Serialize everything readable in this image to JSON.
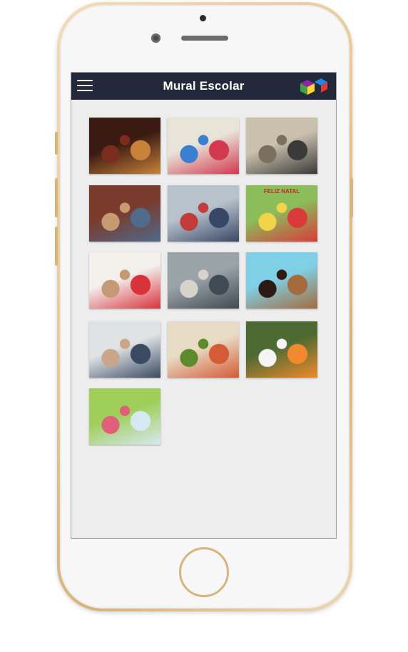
{
  "app": {
    "title": "Mural Escolar",
    "logo_colors": [
      "#8e24aa",
      "#43a047",
      "#fdd835",
      "#1e88e5",
      "#e53935"
    ]
  },
  "gallery": {
    "photos": [
      {
        "icon": "photo-party-crowd",
        "colors": [
          "#3a1a12",
          "#c9823a",
          "#7a2d1c"
        ]
      },
      {
        "icon": "photo-birthday-balloons",
        "colors": [
          "#e8e4d8",
          "#d2384e",
          "#3b7fd0"
        ]
      },
      {
        "icon": "photo-adults-toast",
        "colors": [
          "#c9c1ad",
          "#3b3a3a",
          "#7c6f5e"
        ]
      },
      {
        "icon": "photo-students-group",
        "colors": [
          "#7a3a2c",
          "#4f6a8a",
          "#c89a72"
        ]
      },
      {
        "icon": "photo-volleyball-gym",
        "colors": [
          "#b8c2cc",
          "#394766",
          "#c23b3b"
        ]
      },
      {
        "icon": "photo-christmas-board",
        "colors": [
          "#8bbd5b",
          "#d93b3b",
          "#f1d34a"
        ],
        "caption": "FELIZ NATAL"
      },
      {
        "icon": "photo-easter-costumes",
        "colors": [
          "#f3f0ec",
          "#d8323b",
          "#c49a76"
        ]
      },
      {
        "icon": "photo-classroom",
        "colors": [
          "#9aa3a8",
          "#3f4a52",
          "#d7d3cb"
        ]
      },
      {
        "icon": "photo-two-friends",
        "colors": [
          "#7fd0e6",
          "#a56a3d",
          "#2d1a12"
        ]
      },
      {
        "icon": "photo-teens-phones",
        "colors": [
          "#dfe3e4",
          "#3b4a63",
          "#c9a68a"
        ]
      },
      {
        "icon": "photo-kids-tablet",
        "colors": [
          "#e9dcc6",
          "#d35b36",
          "#5e8a2d"
        ]
      },
      {
        "icon": "photo-kids-outdoor",
        "colors": [
          "#4e6a33",
          "#f08a2c",
          "#f4f4f4"
        ]
      },
      {
        "icon": "photo-kids-celebrating",
        "colors": [
          "#9fcf5a",
          "#d7e8f2",
          "#e0607a"
        ]
      }
    ]
  }
}
